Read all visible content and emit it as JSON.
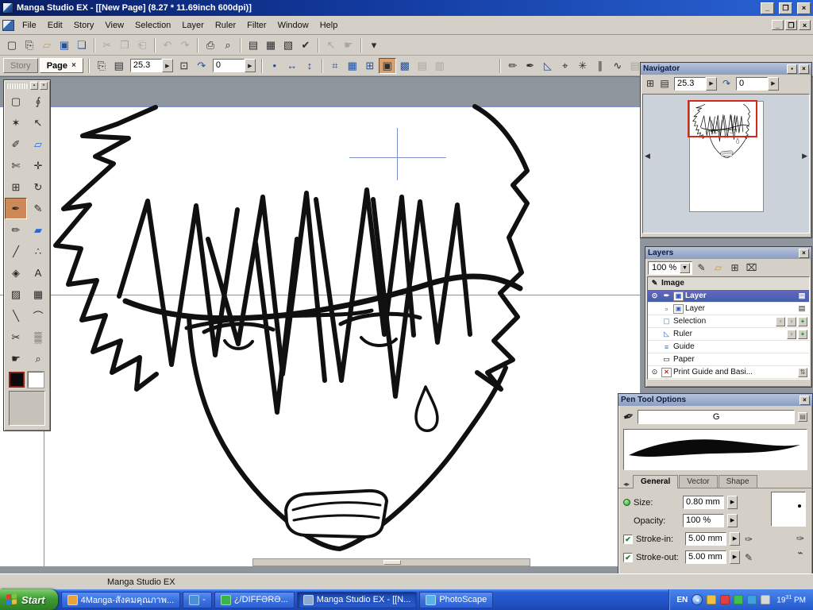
{
  "window": {
    "title": "Manga Studio EX - [[New Page] (8.27 * 11.69inch 600dpi)]",
    "buttons": {
      "minimize": "_",
      "maximize": "❐",
      "close": "×"
    }
  },
  "menubar": {
    "items": [
      {
        "label": "File"
      },
      {
        "label": "Edit"
      },
      {
        "label": "Story"
      },
      {
        "label": "View"
      },
      {
        "label": "Selection"
      },
      {
        "label": "Layer"
      },
      {
        "label": "Ruler"
      },
      {
        "label": "Filter"
      },
      {
        "label": "Window"
      },
      {
        "label": "Help"
      }
    ],
    "child_buttons": {
      "minimize": "_",
      "restore": "❐",
      "close": "×"
    }
  },
  "toolbar_main": {
    "g1": [
      {
        "name": "new-page-icon",
        "glyph": "▢"
      },
      {
        "name": "new-story-icon",
        "glyph": "⎘"
      },
      {
        "name": "open-icon",
        "glyph": "▱",
        "cls": "yellow"
      },
      {
        "name": "save-icon",
        "glyph": "▣",
        "cls": "blue"
      },
      {
        "name": "save-all-icon",
        "glyph": "❏",
        "cls": "blue"
      }
    ],
    "g2": [
      {
        "name": "cut-icon",
        "glyph": "✂",
        "disabled": true
      },
      {
        "name": "copy-icon",
        "glyph": "❐",
        "disabled": true
      },
      {
        "name": "paste-icon",
        "glyph": "⎗",
        "disabled": true
      }
    ],
    "g3": [
      {
        "name": "undo-icon",
        "glyph": "↶",
        "disabled": true
      },
      {
        "name": "redo-icon",
        "glyph": "↷",
        "disabled": true
      }
    ],
    "g4": [
      {
        "name": "print-icon",
        "glyph": "⎙"
      },
      {
        "name": "print-preview-icon",
        "glyph": "⌕"
      }
    ],
    "g5": [
      {
        "name": "story-editor-icon",
        "glyph": "▤",
        "cls": "blue"
      },
      {
        "name": "page-manager-icon",
        "glyph": "▦",
        "cls": "blue"
      },
      {
        "name": "materials-icon",
        "glyph": "▧",
        "cls": "blue"
      },
      {
        "name": "check-icon",
        "glyph": "✔",
        "cls": "green"
      }
    ],
    "g6": [
      {
        "name": "select-mode-icon",
        "glyph": "↖",
        "disabled": true
      },
      {
        "name": "hand-mode-icon",
        "glyph": "☛",
        "disabled": true
      }
    ],
    "g7": [
      {
        "name": "toolbar-options-icon",
        "glyph": "▾"
      }
    ]
  },
  "toolbar_view": {
    "story_tab": "Story",
    "page_tab": "Page",
    "page_tab_close": "×",
    "zoom_value": "25.3",
    "rotation_value": "0",
    "spin_arrow": "▶",
    "icons_a": [
      {
        "name": "page-turn-icon",
        "glyph": "⎘"
      },
      {
        "name": "thumbnail-view-icon",
        "glyph": "▤"
      }
    ],
    "icons_b": [
      {
        "name": "fit-page-icon",
        "glyph": "⊡"
      },
      {
        "name": "rotate-ccw-icon",
        "glyph": "↷",
        "cls": "blue"
      }
    ],
    "icons_c": [
      {
        "name": "reset-view-icon",
        "glyph": "•",
        "cls": "blue"
      },
      {
        "name": "flip-horizontal-icon",
        "glyph": "↔",
        "cls": "blue"
      },
      {
        "name": "flip-vertical-icon",
        "glyph": "↕",
        "cls": "blue"
      }
    ],
    "icons_d": [
      {
        "name": "snap-grid-icon",
        "glyph": "⌗",
        "cls": "blue"
      },
      {
        "name": "snap-tone-icon",
        "glyph": "▦",
        "cls": "blue"
      },
      {
        "name": "snap-perspective-icon",
        "glyph": "⊞",
        "cls": "blue"
      },
      {
        "name": "snap-focus-icon",
        "glyph": "▣",
        "selected": true
      },
      {
        "name": "snap-parallel-icon",
        "glyph": "▩",
        "cls": "blue"
      },
      {
        "name": "snap-off-icon",
        "glyph": "▤",
        "disabled": true
      },
      {
        "name": "snap-hide-icon",
        "glyph": "▥",
        "disabled": true
      }
    ],
    "icons_e": [
      {
        "name": "pencil-mode-icon",
        "glyph": "✏"
      },
      {
        "name": "pen-mode-icon",
        "glyph": "✒"
      },
      {
        "name": "triangle-ruler-icon",
        "glyph": "◺",
        "cls": "blue"
      },
      {
        "name": "compass-icon",
        "glyph": "⌖"
      },
      {
        "name": "burst-ruler-icon",
        "glyph": "✳"
      },
      {
        "name": "parallel-ruler-icon",
        "glyph": "∥"
      },
      {
        "name": "wave-ruler-icon",
        "glyph": "∿"
      },
      {
        "name": "panel-ruler-icon",
        "glyph": "▤",
        "disabled": true
      }
    ]
  },
  "tool_palette": {
    "tools": [
      {
        "name": "rectangle-select-tool",
        "glyph": "▢"
      },
      {
        "name": "lasso-tool",
        "glyph": "∮"
      },
      {
        "name": "magic-wand-tool",
        "glyph": "✶"
      },
      {
        "name": "object-select-tool",
        "glyph": "↖"
      },
      {
        "name": "selection-pen-tool",
        "glyph": "✐"
      },
      {
        "name": "selection-eraser-tool",
        "glyph": "▱",
        "cls": "cblue"
      },
      {
        "name": "frame-cutter-tool",
        "glyph": "✄"
      },
      {
        "name": "move-tool",
        "glyph": "✛"
      },
      {
        "name": "grid-tool",
        "glyph": "⊞"
      },
      {
        "name": "rotate-canvas-tool",
        "glyph": "↻"
      },
      {
        "name": "pen-tool",
        "glyph": "✒",
        "selected": true
      },
      {
        "name": "marker-tool",
        "glyph": "✎"
      },
      {
        "name": "pencil-tool",
        "glyph": "✏"
      },
      {
        "name": "eraser-tool",
        "glyph": "▰",
        "cls": "cblue"
      },
      {
        "name": "brush-tool",
        "glyph": "╱"
      },
      {
        "name": "airbrush-tool",
        "glyph": "∴"
      },
      {
        "name": "fill-tool",
        "glyph": "◈"
      },
      {
        "name": "text-tool",
        "glyph": "A"
      },
      {
        "name": "tone-tool",
        "glyph": "▨"
      },
      {
        "name": "pattern-tool",
        "glyph": "▦"
      },
      {
        "name": "line-tool",
        "glyph": "╲"
      },
      {
        "name": "curve-tool",
        "glyph": "⌒"
      },
      {
        "name": "scissors-tool",
        "glyph": "✂"
      },
      {
        "name": "gradient-tool",
        "glyph": "▒"
      },
      {
        "name": "hand-tool",
        "glyph": "☛"
      },
      {
        "name": "zoom-tool",
        "glyph": "⌕"
      }
    ],
    "foreground_color": "#0a0a0a",
    "background_color": "#ffffff"
  },
  "navigator": {
    "title": "Navigator",
    "zoom_value": "25.3",
    "rotation_value": "0",
    "spin_arrow": "▶",
    "buttons": {
      "minimize": "▪",
      "close": "×"
    }
  },
  "layers": {
    "title": "Layers",
    "close": "×",
    "opacity_value": "100 %",
    "rows": [
      {
        "label": "Image"
      },
      {
        "label": "Layer"
      },
      {
        "label": "Layer"
      },
      {
        "label": "Selection"
      },
      {
        "label": "Ruler"
      },
      {
        "label": "Guide"
      },
      {
        "label": "Paper"
      },
      {
        "label": "Print Guide and Basi..."
      }
    ]
  },
  "pen_options": {
    "title": "Pen Tool Options",
    "close": "×",
    "preset_value": "G",
    "tabs": {
      "general": "General",
      "vector": "Vector",
      "shape": "Shape"
    },
    "size_label": "Size:",
    "size_value": "0.80 mm",
    "opacity_label": "Opacity:",
    "opacity_value": "100 %",
    "stroke_in_label": "Stroke-in:",
    "stroke_in_value": "5.00 mm",
    "stroke_out_label": "Stroke-out:",
    "stroke_out_value": "5.00 mm",
    "check_glyph": "✔"
  },
  "statusbar": {
    "text": "Manga Studio EX"
  },
  "taskbar": {
    "start_label": "Start",
    "tasks": [
      {
        "label": "4Manga-สังคมคุณภาพ...",
        "icon_color": "#e8a33d"
      },
      {
        "label": "-",
        "icon_color": "#4a90d9"
      },
      {
        "label": "¿/DIFFƏRƏ...",
        "icon_color": "#3ab54a"
      },
      {
        "label": "Manga Studio EX - [[N...",
        "icon_color": "#8aa8d8",
        "active": true
      },
      {
        "label": "PhotoScape",
        "icon_color": "#5ab0e8"
      }
    ],
    "tray": {
      "lang": "EN",
      "time_hours": "19",
      "time_minutes": "31",
      "time_suffix": "PM"
    }
  },
  "accent_colors": {
    "guide_blue": "#7d90c9",
    "viewport_red": "#d42a1e",
    "selection_blue": "#4060b0",
    "taskbar_blue": "#2453c8",
    "start_green": "#3f9c34"
  }
}
